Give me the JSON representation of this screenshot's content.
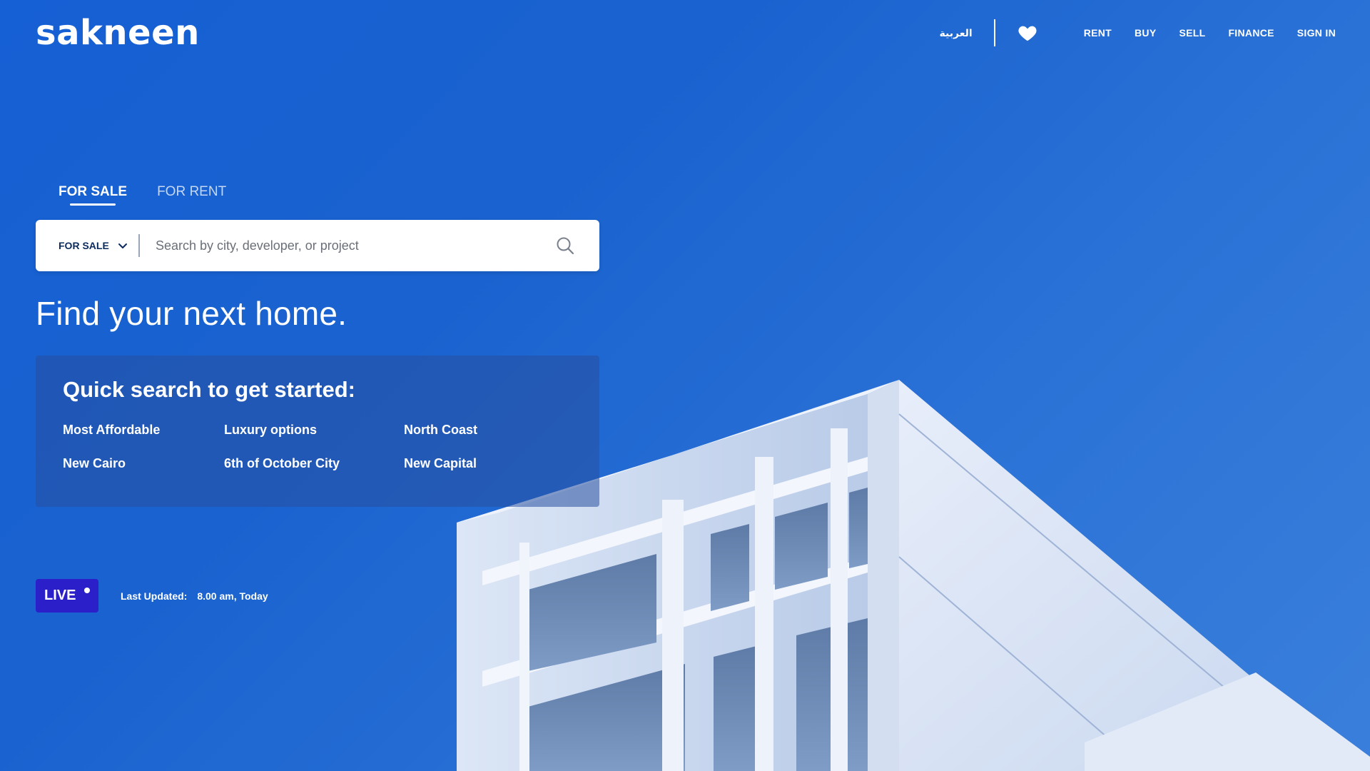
{
  "header": {
    "logo": "sakneen",
    "language_link": "العربية",
    "favorites_icon": "heart-icon",
    "nav": [
      "RENT",
      "BUY",
      "SELL",
      "FINANCE",
      "SIGN IN"
    ]
  },
  "tabs": [
    {
      "label": "FOR SALE",
      "active": true
    },
    {
      "label": "FOR RENT",
      "active": false
    }
  ],
  "search": {
    "mode_value": "FOR SALE",
    "placeholder": "Search by city, developer, or project",
    "icon": "search-icon"
  },
  "hero": {
    "title": "Find your next home."
  },
  "quick_search": {
    "title": "Quick search to get started:",
    "items": [
      "Most Affordable",
      "Luxury options",
      "North Coast",
      "New Cairo",
      "6th of October City",
      "New Capital"
    ]
  },
  "live": {
    "badge": "LIVE",
    "updated_label": "Last Updated:",
    "updated_value": "8.00 am, Today"
  },
  "colors": {
    "background": "#1a62cf",
    "live_badge": "#2a1fc9",
    "search_text": "#0b2a5e"
  }
}
